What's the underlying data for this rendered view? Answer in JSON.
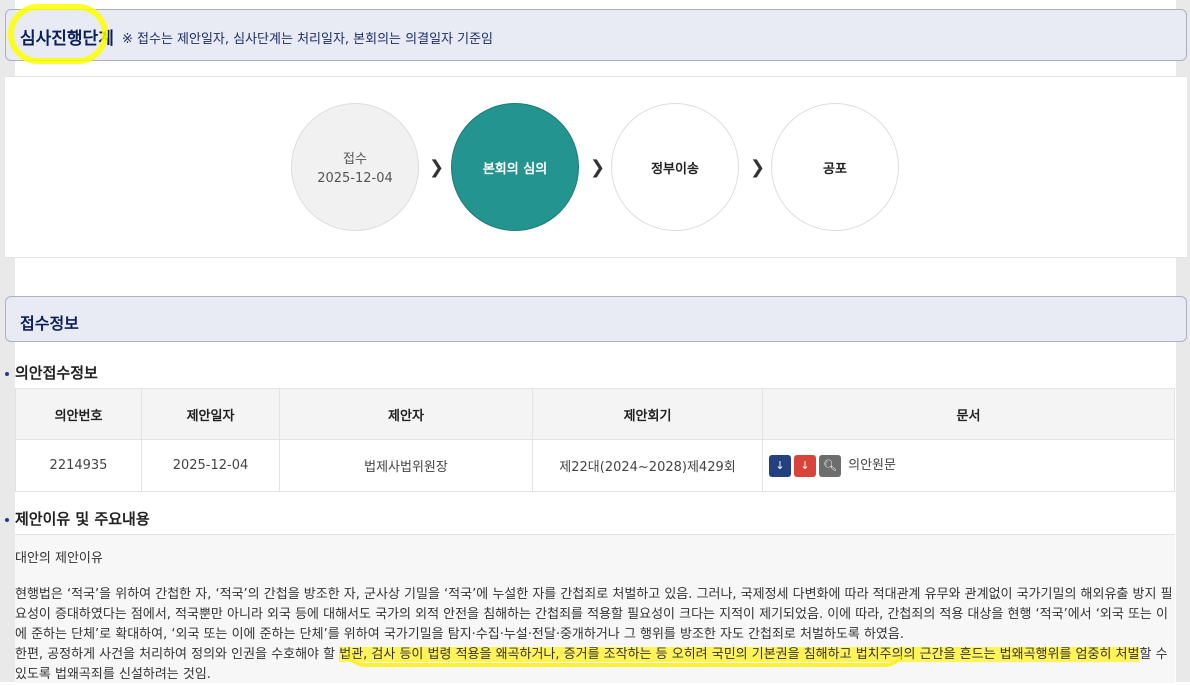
{
  "header": {
    "title": "심사진행단계",
    "note": "※ 접수는 제안일자, 심사단계는 처리일자, 본회의는 의결일자 기준임"
  },
  "steps": [
    {
      "label": "접수",
      "date": "2025-12-04",
      "state": "done"
    },
    {
      "label": "본회의 심의",
      "date": "",
      "state": "active"
    },
    {
      "label": "정부이송",
      "date": "",
      "state": "todo"
    },
    {
      "label": "공포",
      "date": "",
      "state": "todo"
    }
  ],
  "reception": {
    "title": "접수정보",
    "sub_title": "의안접수정보",
    "columns": [
      "의안번호",
      "제안일자",
      "제안자",
      "제안회기",
      "문서"
    ],
    "row": {
      "bill_no": "2214935",
      "date": "2025-12-04",
      "proposer": "법제사법위원장",
      "session": "제22대(2024~2028)제429회",
      "doc_label": "의안원문"
    }
  },
  "reason": {
    "title": "제안이유 및 주요내용",
    "head": "대안의 제안이유",
    "para1": " 현행법은 ‘적국’을 위하여 간첩한 자, ‘적국’의 간첩을 방조한 자, 군사상 기밀을 ‘적국’에 누설한 자를 간첩죄로 처벌하고 있음. 그러나, 국제정세 다변화에 따라 적대관계 유무와 관계없이 국가기밀의 해외유출 방지 필요성이 증대하였다는 점에서, 적국뿐만 아니라 외국 등에 대해서도 국가의 외적 안전을 침해하는 간첩죄를 적용할 필요성이 크다는 지적이 제기되었음. 이에 따라, 간첩죄의 적용 대상을 현행 ‘적국’에서 ‘외국 또는 이에 준하는 단체’로 확대하여, ‘외국 또는 이에 준하는 단체’를 위하여 국가기밀을 탐지·수집·누설·전달·중개하거나 그 행위를 방조한 자도 간첩죄로 처벌하도록 하였음.",
    "para2_pre": " 한편, 공정하게 사건을 처리하여 정의와 인권을 수호해야 할 ",
    "para2_hl": "법관, 검사 등이 법령 적용을 왜곡하거나, 증거를 조작하는 등 오히려 국민의 기본권을 침해하고 법치주의의 근간을 흔드는 법왜곡행위를 엄중히 처벌",
    "para2_post": "할 수 있도록 법왜곡죄를 신설하려는 것임."
  }
}
